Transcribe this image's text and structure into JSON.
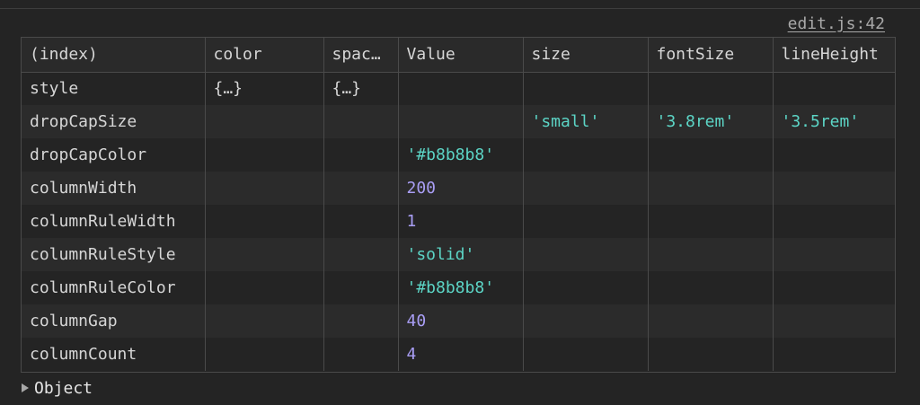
{
  "source_link": "edit.js:42",
  "table": {
    "columns": [
      "(index)",
      "color",
      "spac…",
      "Value",
      "size",
      "fontSize",
      "lineHeight"
    ],
    "rows": [
      {
        "index": "style",
        "color": "{…}",
        "spacing": "{…}",
        "value": "",
        "value_type": "",
        "size": "",
        "fontSize": "",
        "lineHeight": ""
      },
      {
        "index": "dropCapSize",
        "color": "",
        "spacing": "",
        "value": "",
        "value_type": "",
        "size": "'small'",
        "fontSize": "'3.8rem'",
        "lineHeight": "'3.5rem'"
      },
      {
        "index": "dropCapColor",
        "color": "",
        "spacing": "",
        "value": "'#b8b8b8'",
        "value_type": "string",
        "size": "",
        "fontSize": "",
        "lineHeight": ""
      },
      {
        "index": "columnWidth",
        "color": "",
        "spacing": "",
        "value": "200",
        "value_type": "number",
        "size": "",
        "fontSize": "",
        "lineHeight": ""
      },
      {
        "index": "columnRuleWidth",
        "color": "",
        "spacing": "",
        "value": "1",
        "value_type": "number",
        "size": "",
        "fontSize": "",
        "lineHeight": ""
      },
      {
        "index": "columnRuleStyle",
        "color": "",
        "spacing": "",
        "value": "'solid'",
        "value_type": "string",
        "size": "",
        "fontSize": "",
        "lineHeight": ""
      },
      {
        "index": "columnRuleColor",
        "color": "",
        "spacing": "",
        "value": "'#b8b8b8'",
        "value_type": "string",
        "size": "",
        "fontSize": "",
        "lineHeight": ""
      },
      {
        "index": "columnGap",
        "color": "",
        "spacing": "",
        "value": "40",
        "value_type": "number",
        "size": "",
        "fontSize": "",
        "lineHeight": ""
      },
      {
        "index": "columnCount",
        "color": "",
        "spacing": "",
        "value": "4",
        "value_type": "number",
        "size": "",
        "fontSize": "",
        "lineHeight": ""
      }
    ]
  },
  "object_label": "Object",
  "colors": {
    "background": "#242424",
    "string_value": "#5cd5c6",
    "number_value": "#a99ef5",
    "border": "#4a4a4a",
    "text": "#d6d6d6"
  },
  "icons": {
    "expand": "expand-triangle-icon"
  }
}
